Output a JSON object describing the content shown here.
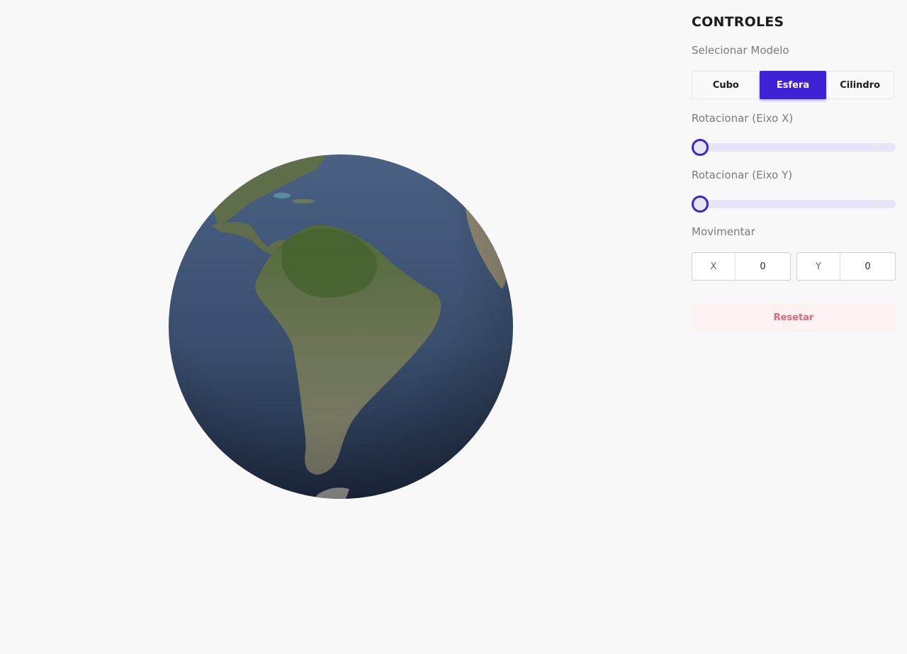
{
  "panel": {
    "title": "CONTROLES",
    "model_label": "Selecionar Modelo",
    "models": [
      {
        "label": "Cubo",
        "active": false
      },
      {
        "label": "Esfera",
        "active": true
      },
      {
        "label": "Cilindro",
        "active": false
      }
    ],
    "rotate_x_label": "Rotacionar (Eixo X)",
    "rotate_x_value": 0,
    "rotate_y_label": "Rotacionar (Eixo Y)",
    "rotate_y_value": 0,
    "move_label": "Movimentar",
    "move_x": {
      "prefix": "X",
      "value": "0"
    },
    "move_y": {
      "prefix": "Y",
      "value": "0"
    },
    "reset_label": "Resetar"
  },
  "colors": {
    "accent": "#3f22d6",
    "slider_track": "#e7e4f7",
    "reset_text": "#e0667a",
    "reset_bg": "#fdf1f1"
  },
  "scene": {
    "model": "sphere",
    "texture": "earth-south-america"
  }
}
